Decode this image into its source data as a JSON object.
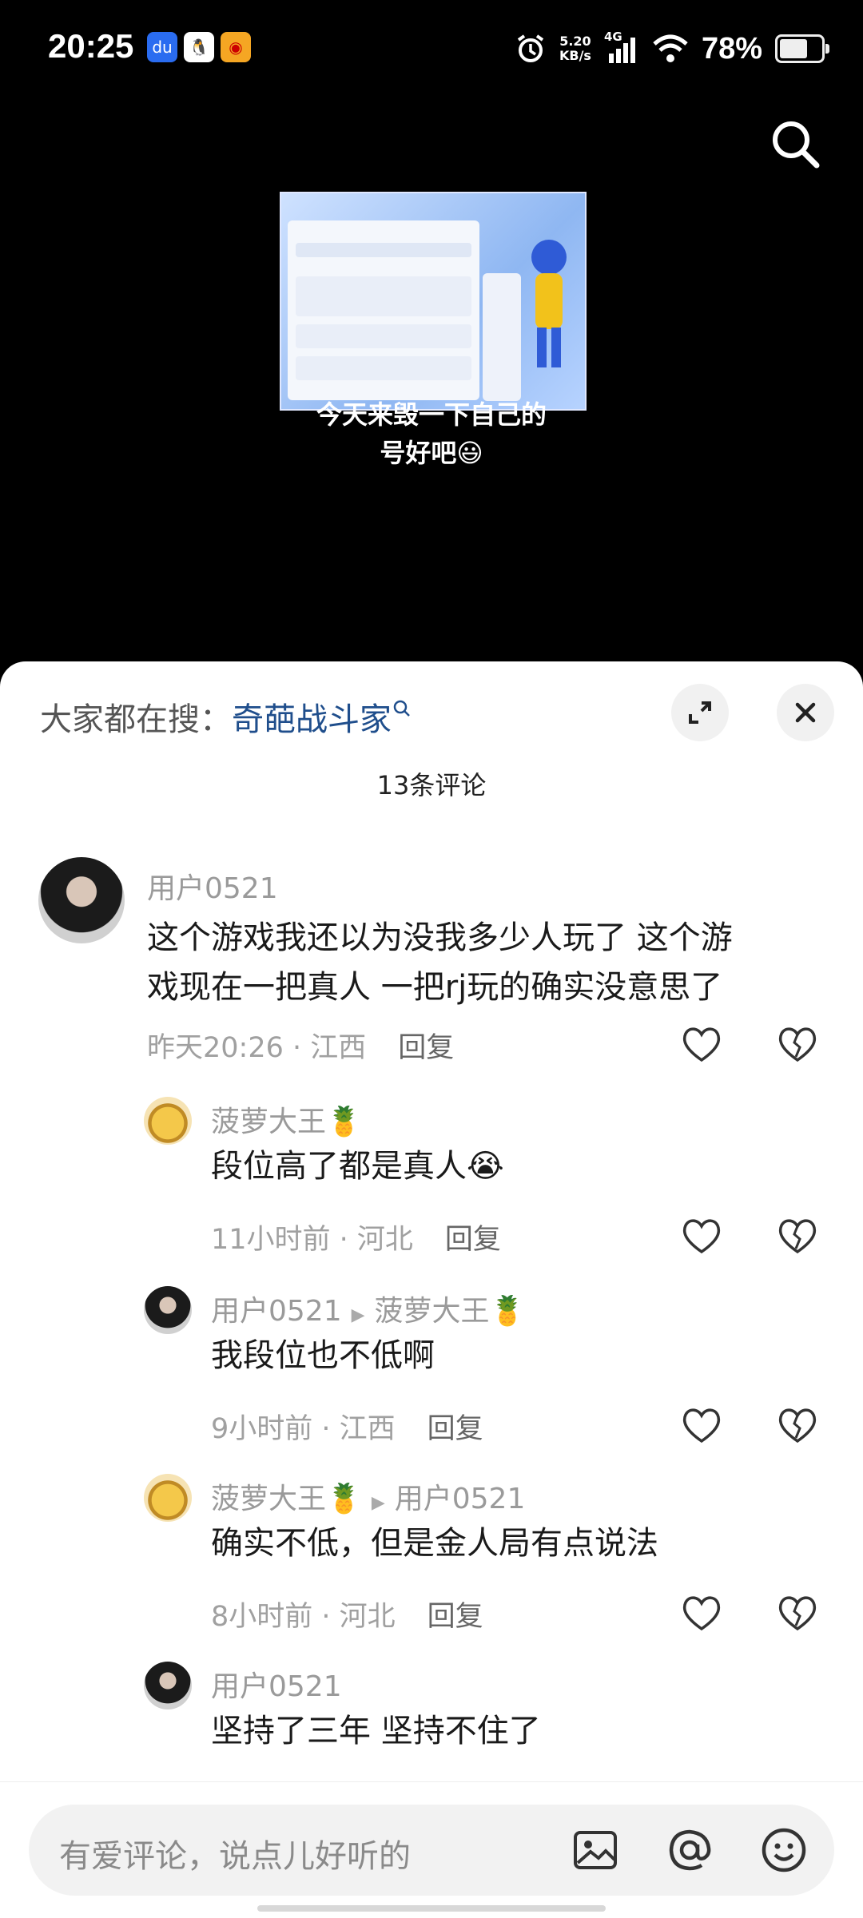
{
  "status_bar": {
    "time": "20:25",
    "net_speed_value": "5.20",
    "net_speed_unit": "KB/s",
    "network": "4G",
    "battery": "78%"
  },
  "video": {
    "caption_line1": "今天来毁一下自己的",
    "caption_line2": "号好吧😃"
  },
  "sheet": {
    "trending_prefix": "大家都在搜：",
    "trending_keyword": "奇葩战斗家",
    "comment_count": "13条评论"
  },
  "comments": [
    {
      "user": "用户0521",
      "text_line1": "这个游戏我还以为没我多少人玩了 这个游",
      "text_line2": "戏现在一把真人 一把rj玩的确实没意思了",
      "time_loc": "昨天20:26 · 江西",
      "reply": "回复"
    },
    {
      "user": "菠萝大王🍍",
      "text": "段位高了都是真人😭",
      "time_loc": "11小时前 · 河北",
      "reply": "回复"
    },
    {
      "user": "用户0521",
      "reply_to": "菠萝大王🍍",
      "text": "我段位也不低啊",
      "time_loc": "9小时前 · 江西",
      "reply": "回复"
    },
    {
      "user": "菠萝大王🍍",
      "reply_to": "用户0521",
      "text": "确实不低，但是金人局有点说法",
      "time_loc": "8小时前 · 河北",
      "reply": "回复"
    },
    {
      "user": "用户0521",
      "text": "坚持了三年 坚持不住了"
    }
  ],
  "input": {
    "placeholder": "有爱评论，说点儿好听的"
  },
  "icons": {
    "search": "search-icon",
    "expand": "expand-icon",
    "close": "close-icon",
    "like": "heart-icon",
    "dislike": "broken-heart-icon",
    "image": "image-icon",
    "mention": "at-icon",
    "emoji": "emoji-icon"
  }
}
